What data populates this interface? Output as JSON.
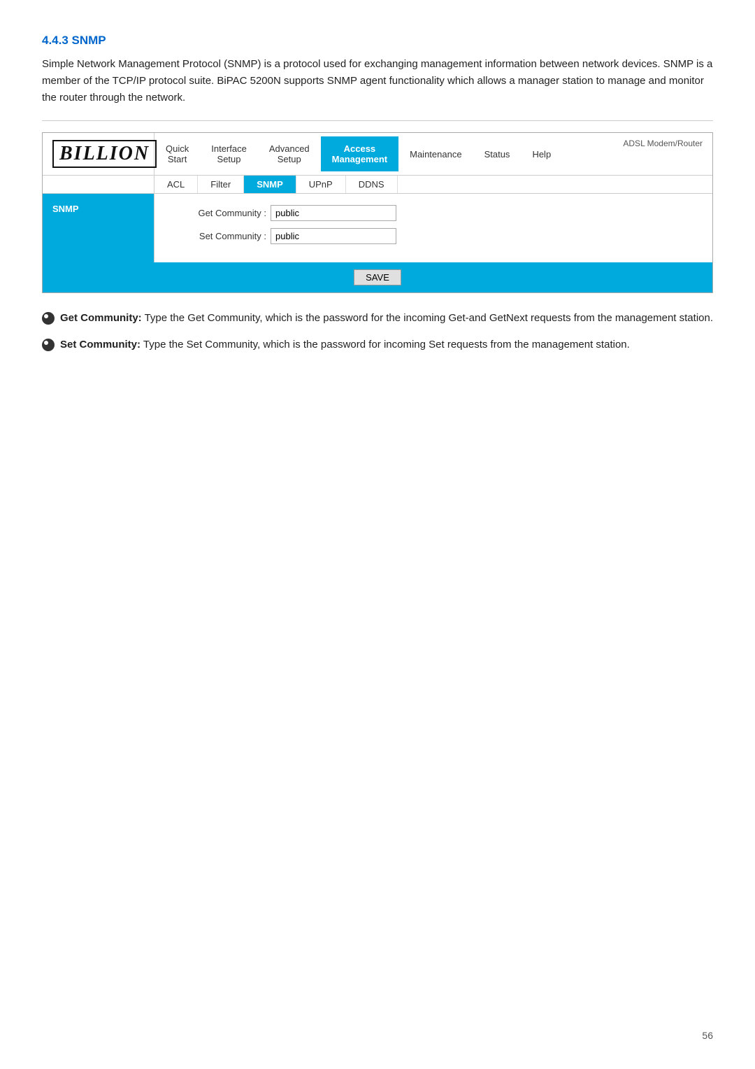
{
  "section": {
    "title": "4.4.3 SNMP",
    "intro": "Simple Network Management Protocol (SNMP) is a protocol used for exchanging management information between network devices. SNMP is a member of the TCP/IP protocol suite. BiPAC 5200N supports SNMP agent functionality which allows a manager station to manage and monitor the router through the network."
  },
  "router_ui": {
    "logo": "BILLION",
    "adsl_label": "ADSL Modem/Router",
    "nav": [
      {
        "label": "Quick\nStart",
        "active": false
      },
      {
        "label": "Interface\nSetup",
        "active": false
      },
      {
        "label": "Advanced\nSetup",
        "active": false
      },
      {
        "label": "Access\nManagement",
        "active": true
      },
      {
        "label": "Maintenance",
        "active": false
      },
      {
        "label": "Status",
        "active": false
      },
      {
        "label": "Help",
        "active": false
      }
    ],
    "sub_tabs": [
      {
        "label": "ACL",
        "active": false
      },
      {
        "label": "Filter",
        "active": false
      },
      {
        "label": "SNMP",
        "active": true
      },
      {
        "label": "UPnP",
        "active": false
      },
      {
        "label": "DDNS",
        "active": false
      }
    ],
    "sidebar": {
      "items": [
        {
          "label": "SNMP",
          "active": true
        }
      ]
    },
    "form": {
      "get_community_label": "Get Community :",
      "get_community_value": "public",
      "set_community_label": "Set Community :",
      "set_community_value": "public"
    },
    "save_button_label": "SAVE"
  },
  "descriptions": [
    {
      "bold": "Get Community:",
      "text": " Type the Get Community, which is the password for the incoming Get-and GetNext requests from the management station."
    },
    {
      "bold": "Set Community:",
      "text": " Type the Set Community, which is the password for incoming Set requests from the management station."
    }
  ],
  "page_number": "56"
}
